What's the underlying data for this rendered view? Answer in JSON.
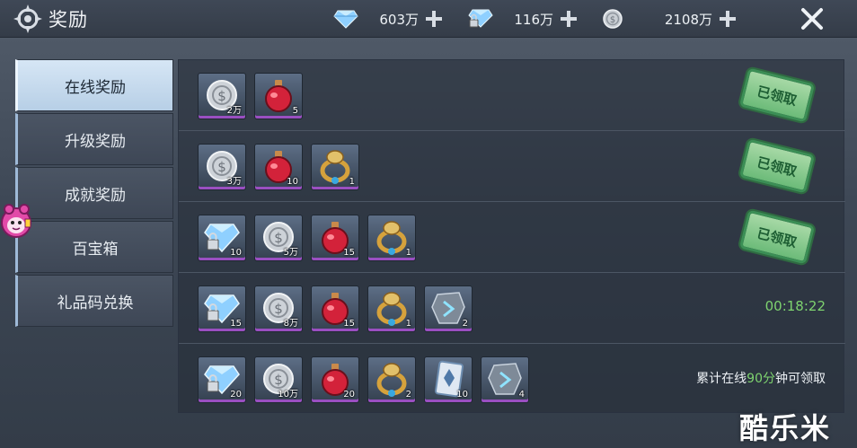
{
  "header": {
    "title": "奖励",
    "currencies": [
      {
        "icon": "diamond-icon",
        "value": "603万"
      },
      {
        "icon": "locked-diamond-icon",
        "value": "116万"
      },
      {
        "icon": "silver-coin-icon",
        "value": "2108万"
      }
    ]
  },
  "sidebar": {
    "tabs": [
      {
        "label": "在线奖励",
        "active": true
      },
      {
        "label": "升级奖励",
        "active": false
      },
      {
        "label": "成就奖励",
        "active": false
      },
      {
        "label": "百宝箱",
        "active": false
      },
      {
        "label": "礼品码兑换",
        "active": false
      }
    ]
  },
  "rows": [
    {
      "items": [
        {
          "icon": "silver-coin-icon",
          "count": "2万"
        },
        {
          "icon": "red-potion-icon",
          "count": "5"
        }
      ],
      "status": "claimed",
      "stamp": "已领取"
    },
    {
      "items": [
        {
          "icon": "silver-coin-icon",
          "count": "3万"
        },
        {
          "icon": "red-potion-icon",
          "count": "10"
        },
        {
          "icon": "gold-ring-icon",
          "count": "1"
        }
      ],
      "status": "claimed",
      "stamp": "已领取"
    },
    {
      "items": [
        {
          "icon": "locked-diamond-icon",
          "count": "10"
        },
        {
          "icon": "silver-coin-icon",
          "count": "5万"
        },
        {
          "icon": "red-potion-icon",
          "count": "15"
        },
        {
          "icon": "gold-ring-icon",
          "count": "1"
        }
      ],
      "status": "claimed",
      "stamp": "已领取"
    },
    {
      "items": [
        {
          "icon": "locked-diamond-icon",
          "count": "15"
        },
        {
          "icon": "silver-coin-icon",
          "count": "8万"
        },
        {
          "icon": "red-potion-icon",
          "count": "15"
        },
        {
          "icon": "gold-ring-icon",
          "count": "1"
        },
        {
          "icon": "crystal-stone-icon",
          "count": "2"
        }
      ],
      "status": "timer",
      "timer": "00:18:22"
    },
    {
      "items": [
        {
          "icon": "locked-diamond-icon",
          "count": "20"
        },
        {
          "icon": "silver-coin-icon",
          "count": "10万"
        },
        {
          "icon": "red-potion-icon",
          "count": "20"
        },
        {
          "icon": "gold-ring-icon",
          "count": "2"
        },
        {
          "icon": "skill-card-icon",
          "count": "10"
        },
        {
          "icon": "crystal-stone-icon",
          "count": "4"
        }
      ],
      "status": "hint",
      "hint": {
        "prefix": "累计在线",
        "highlight": "90分",
        "suffix": "钟可领取"
      }
    }
  ],
  "watermark": "酷乐米",
  "colors": {
    "highlight_green": "#7ed36f",
    "active_tab": "#c8dcef",
    "rarity_purple": "#9a4fc1"
  }
}
